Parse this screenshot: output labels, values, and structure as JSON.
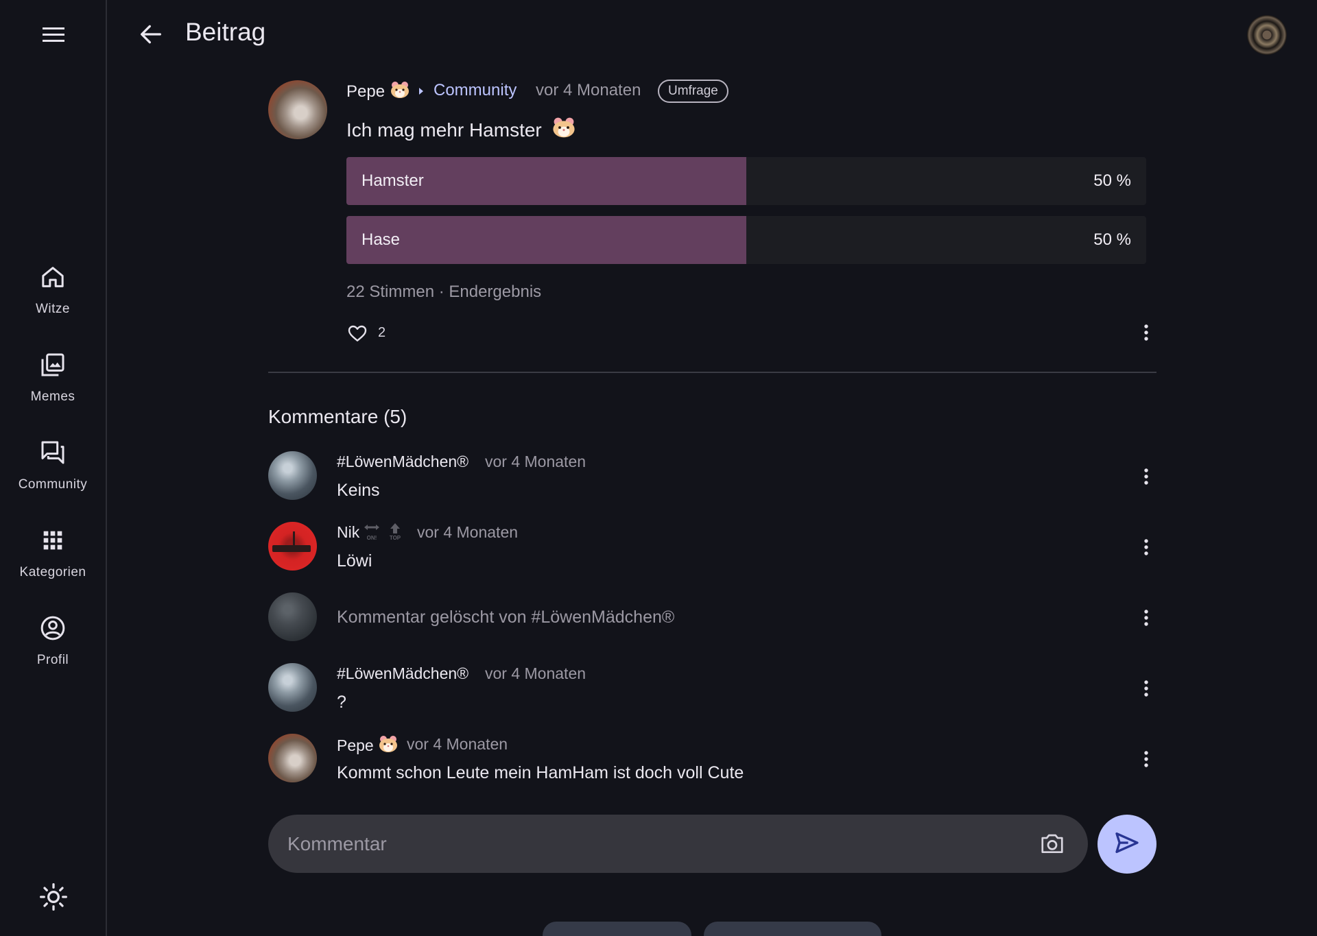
{
  "header": {
    "title": "Beitrag"
  },
  "sidebar": {
    "items": [
      {
        "label": "Witze",
        "icon": "home-icon"
      },
      {
        "label": "Memes",
        "icon": "image-library-icon"
      },
      {
        "label": "Community",
        "icon": "forum-icon"
      },
      {
        "label": "Kategorien",
        "icon": "grid-icon"
      },
      {
        "label": "Profil",
        "icon": "account-circle-icon"
      }
    ]
  },
  "post": {
    "author": "Pepe",
    "community": "Community",
    "time": "vor 4 Monaten",
    "badge": "Umfrage",
    "text": "Ich mag mehr Hamster",
    "poll": {
      "options": [
        {
          "label": "Hamster",
          "percent_label": "50 %",
          "share": 0.5
        },
        {
          "label": "Hase",
          "percent_label": "50 %",
          "share": 0.5
        }
      ],
      "meta": "22 Stimmen · Endergebnis"
    },
    "likes": "2"
  },
  "comments": {
    "title": "Kommentare (5)",
    "items": [
      {
        "author": "#LöwenMädchen®",
        "time": "vor 4 Monaten",
        "text": "Keins"
      },
      {
        "author": "Nik",
        "time": "vor 4 Monaten",
        "text": "Löwi",
        "badges": [
          "ON!",
          "TOP"
        ]
      },
      {
        "deleted_text": "Kommentar gelöscht von #LöwenMädchen®"
      },
      {
        "author": "#LöwenMädchen®",
        "time": "vor 4 Monaten",
        "text": "?"
      },
      {
        "author": "Pepe",
        "time": "vor 4 Monaten",
        "text": "Kommt schon Leute mein HamHam ist doch voll Cute"
      }
    ]
  },
  "composer": {
    "placeholder": "Kommentar"
  },
  "colors": {
    "accent": "#bcc4ff",
    "poll_fill": "#633f5e",
    "background": "#12131a"
  }
}
